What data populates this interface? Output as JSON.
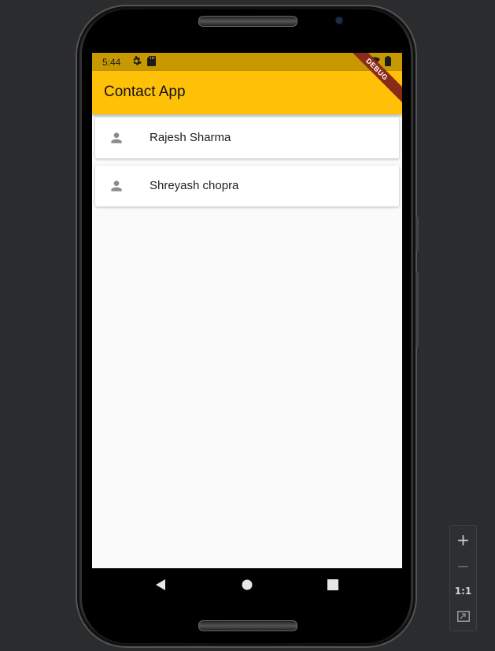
{
  "status_bar": {
    "time": "5:44",
    "icons": [
      "gear-icon",
      "sd-card-icon",
      "wifi-icon",
      "battery-icon"
    ]
  },
  "app_bar": {
    "title": "Contact App",
    "color": "#ffc107",
    "debug_label": "DEBUG"
  },
  "contacts": [
    {
      "name": "Rajesh Sharma",
      "icon": "person-icon"
    },
    {
      "name": "Shreyash chopra",
      "icon": "person-icon"
    }
  ],
  "nav_bar": {
    "buttons": [
      "back-icon",
      "home-icon",
      "recents-icon"
    ]
  },
  "zoom_controls": {
    "zoom_in": "+",
    "zoom_out": "−",
    "actual_size": "1:1",
    "fit_icon": "fit-screen-icon"
  }
}
